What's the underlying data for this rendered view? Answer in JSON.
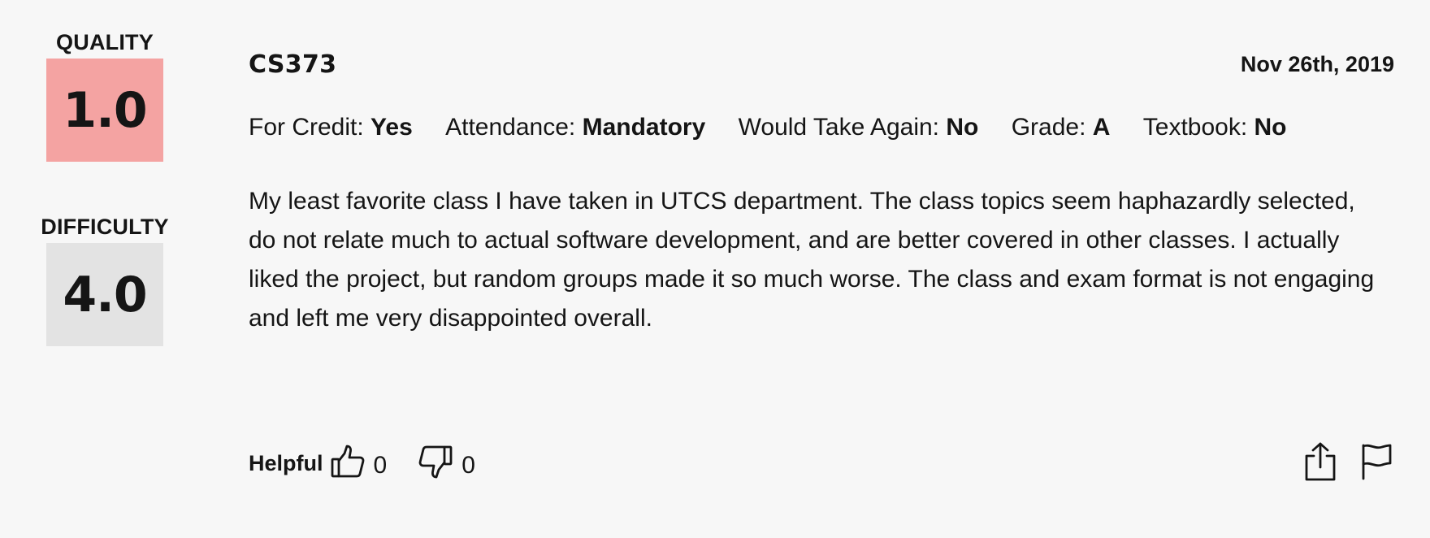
{
  "scores": {
    "quality": {
      "label": "QUALITY",
      "value": "1.0",
      "color": "#f4a3a2"
    },
    "difficulty": {
      "label": "DIFFICULTY",
      "value": "4.0",
      "color": "#e3e3e3"
    }
  },
  "review": {
    "course": "CS373",
    "date": "Nov 26th, 2019",
    "meta": [
      {
        "label": "For Credit: ",
        "value": "Yes"
      },
      {
        "label": "Attendance: ",
        "value": "Mandatory"
      },
      {
        "label": "Would Take Again: ",
        "value": "No"
      },
      {
        "label": "Grade: ",
        "value": "A"
      },
      {
        "label": "Textbook: ",
        "value": "No"
      }
    ],
    "comment": "My least favorite class I have taken in UTCS department. The class topics seem haphazardly selected, do not relate much to actual software development, and are better covered in other classes. I actually liked the project, but random groups made it so much worse. The class and exam format is not engaging and left me very disappointed overall."
  },
  "footer": {
    "helpful_label": "Helpful",
    "thumbs_up_count": "0",
    "thumbs_down_count": "0",
    "icons": {
      "thumbs_up": "thumbs-up-icon",
      "thumbs_down": "thumbs-down-icon",
      "share": "share-icon",
      "flag": "flag-icon"
    }
  }
}
